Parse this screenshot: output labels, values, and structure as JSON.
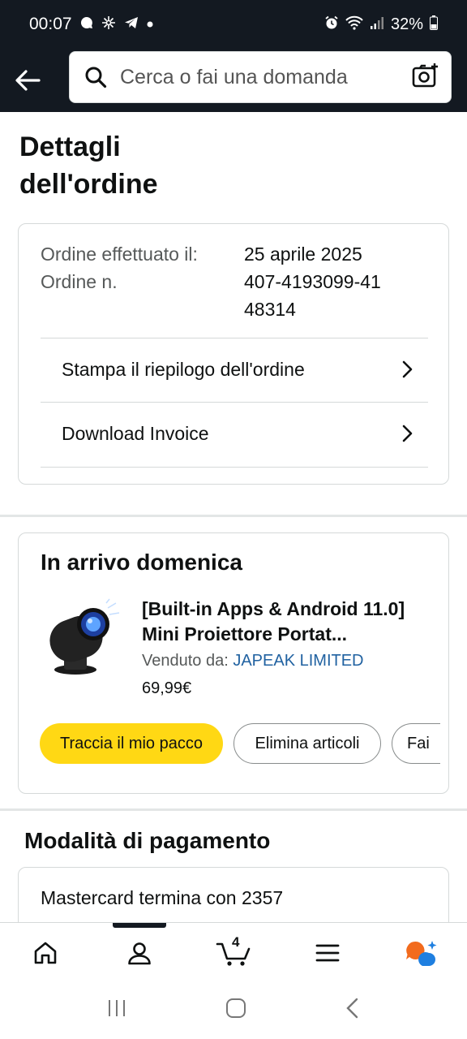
{
  "status_bar": {
    "time": "00:07",
    "battery": "32%",
    "icons": [
      "chat-bubble-icon",
      "snowflake-fan-icon",
      "telegram-icon",
      "dot-icon",
      "alarm-icon",
      "wifi-icon",
      "signal-icon",
      "battery-icon"
    ]
  },
  "header": {
    "search_placeholder": "Cerca o fai una domanda"
  },
  "page": {
    "title": "Dettagli dell'ordine"
  },
  "order": {
    "placed_label": "Ordine effettuato il:",
    "placed_value": "25 aprile 2025",
    "number_label": "Ordine n.",
    "number_value": "407-4193099-4148314",
    "links": [
      {
        "label": "Stampa il riepilogo dell'ordine"
      },
      {
        "label": "Download Invoice"
      }
    ]
  },
  "shipment": {
    "arrival": "In arrivo domenica",
    "product_title": "[Built-in Apps & Android 11.0] Mini Proiettore Portat...",
    "sold_by_label": "Venduto da:",
    "seller": "JAPEAK LIMITED",
    "price": "69,99€",
    "actions": [
      "Traccia il mio pacco",
      "Elimina articoli",
      "Fai"
    ]
  },
  "payment": {
    "title": "Modalità di pagamento",
    "method": "Mastercard termina con 2357"
  },
  "bottom_nav": {
    "cart_count": "4",
    "items": [
      "home-icon",
      "account-icon",
      "cart-icon",
      "menu-icon",
      "rufus-icon"
    ]
  },
  "colors": {
    "header_bg": "#131921",
    "primary_button": "#ffd814",
    "link": "#2162a1",
    "rufus_orange": "#f26b1d",
    "rufus_blue": "#1f7fe0"
  }
}
